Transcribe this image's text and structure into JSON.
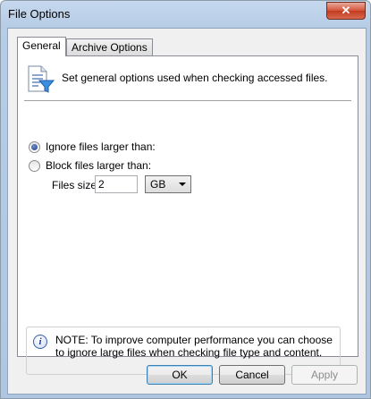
{
  "window": {
    "title": "File Options",
    "close_symbol": "✕"
  },
  "tabs": [
    {
      "label": "General",
      "active": true
    },
    {
      "label": "Archive Options",
      "active": false
    }
  ],
  "general": {
    "description": "Set general options used when checking accessed files.",
    "icon": "document-filter-icon",
    "options": [
      {
        "label": "Ignore files larger than:",
        "checked": true
      },
      {
        "label": "Block files larger than:",
        "checked": false
      }
    ],
    "size_label": "Files size:",
    "size_value": "2",
    "unit": "GB",
    "note_icon": "info-icon",
    "note": "NOTE: To improve computer performance you can choose to ignore large files when checking file type and content."
  },
  "buttons": {
    "ok": "OK",
    "cancel": "Cancel",
    "apply": "Apply"
  }
}
